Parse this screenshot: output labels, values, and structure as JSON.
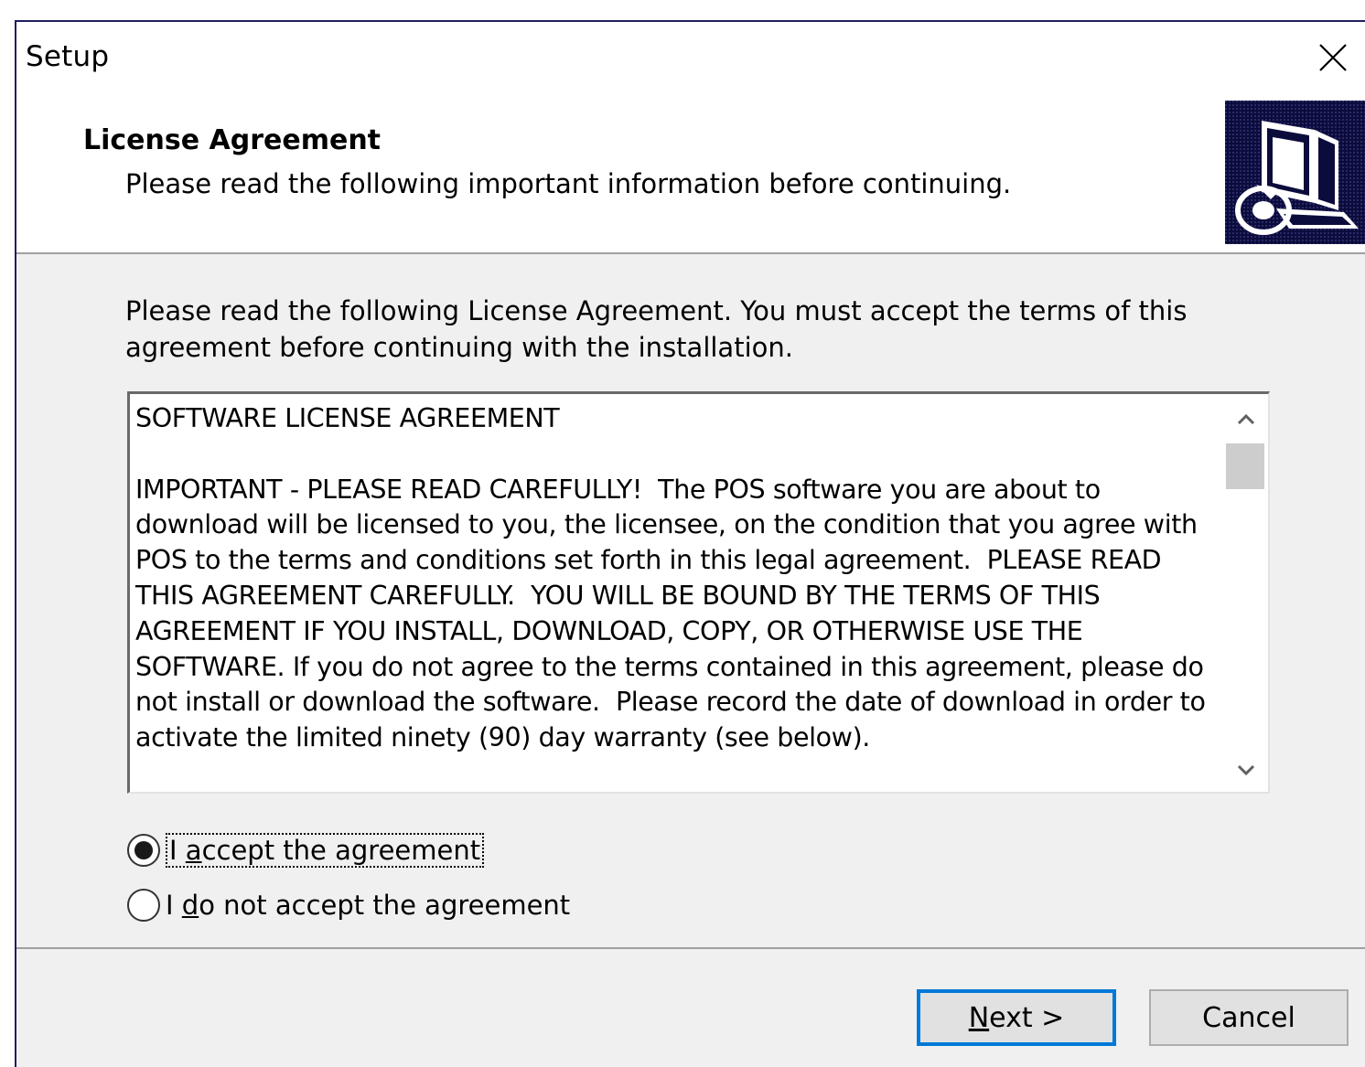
{
  "window": {
    "title": "Setup"
  },
  "header": {
    "title": "License Agreement",
    "subtitle": "Please read the following important information before continuing."
  },
  "main": {
    "instructions": "Please read the following License Agreement. You must accept the terms of this agreement before continuing with the installation.",
    "license_text": "SOFTWARE LICENSE AGREEMENT\n\nIMPORTANT - PLEASE READ CAREFULLY!  The POS software you are about to download will be licensed to you, the licensee, on the condition that you agree with POS to the terms and conditions set forth in this legal agreement.  PLEASE READ THIS AGREEMENT CAREFULLY.  YOU WILL BE BOUND BY THE TERMS OF THIS AGREEMENT IF YOU INSTALL, DOWNLOAD, COPY, OR OTHERWISE USE THE SOFTWARE. If you do not agree to the terms contained in this agreement, please do not install or download the software.  Please record the date of download in order to activate the limited ninety (90) day warranty (see below).",
    "radio_accept": {
      "prefix": "I ",
      "accel": "a",
      "rest": "ccept the agreement",
      "selected": true
    },
    "radio_decline": {
      "prefix": "I ",
      "accel": "d",
      "rest": "o not accept the agreement",
      "selected": false
    }
  },
  "footer": {
    "next": {
      "accel": "N",
      "rest": "ext >"
    },
    "cancel": "Cancel"
  },
  "icons": {
    "close": "close-icon",
    "setup": "setup-computer-icon",
    "scroll_up": "chevron-up-icon",
    "scroll_down": "chevron-down-icon"
  },
  "colors": {
    "focus_border": "#0078d7",
    "header_bg": "#ffffff",
    "body_bg": "#f0f0f0",
    "icon_bg": "#0c0c3c"
  }
}
